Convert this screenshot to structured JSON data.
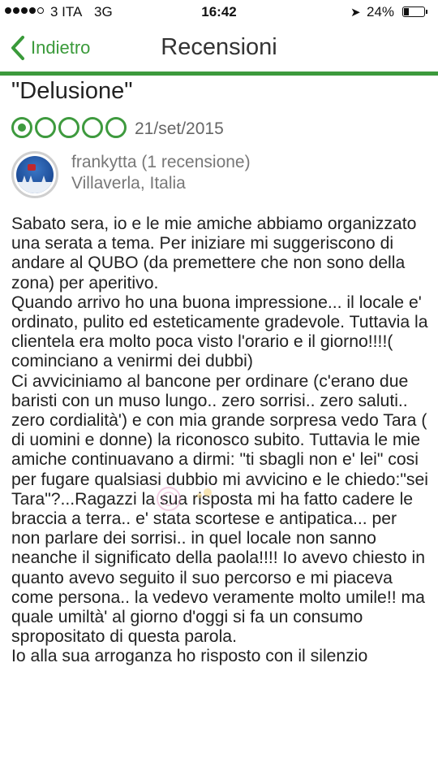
{
  "status_bar": {
    "carrier": "3 ITA",
    "network": "3G",
    "time": "16:42",
    "battery": "24%",
    "battery_level": 0.24,
    "signal_bars": 4
  },
  "nav": {
    "back_label": "Indietro",
    "title": "Recensioni"
  },
  "review": {
    "title": "\"Delusione\"",
    "rating": 1,
    "rating_max": 5,
    "date": "21/set/2015",
    "username": "frankytta (1 recensione)",
    "location": "Villaverla, Italia",
    "paragraphs": [
      "Sabato sera, io e le mie amiche abbiamo organizzato una serata a tema. Per iniziare mi suggeriscono di andare al QUBO (da premettere che non sono della zona) per aperitivo.",
      "Quando arrivo ho una buona impressione... il locale e' ordinato, pulito ed esteticamente gradevole. Tuttavia la clientela era molto poca visto l'orario e il giorno!!!!( cominciano a venirmi dei dubbi)",
      "Ci avviciniamo al bancone per ordinare (c'erano due baristi con un muso lungo.. zero sorrisi.. zero saluti.. zero cordialità') e con mia grande sorpresa vedo Tara ( di uomini e donne) la riconosco subito. Tuttavia le mie amiche continuavano a dirmi: \"ti sbagli non e' lei\" cosi per fugare qualsiasi dubbio mi avvicino e le chiedo:\"sei Tara\"?...Ragazzi la sua risposta mi ha fatto cadere le braccia a terra.. e' stata scortese e antipatica... per non parlare dei sorrisi.. in quel locale non sanno neanche il significato della paola!!!! Io avevo chiesto in quanto avevo seguito il suo percorso e mi piaceva come persona.. la vedevo veramente molto umile!! ma quale umiltà' al giorno d'oggi si fa un consumo spropositato di questa parola.",
      "Io alla sua arroganza ho risposto con il silenzio"
    ]
  }
}
